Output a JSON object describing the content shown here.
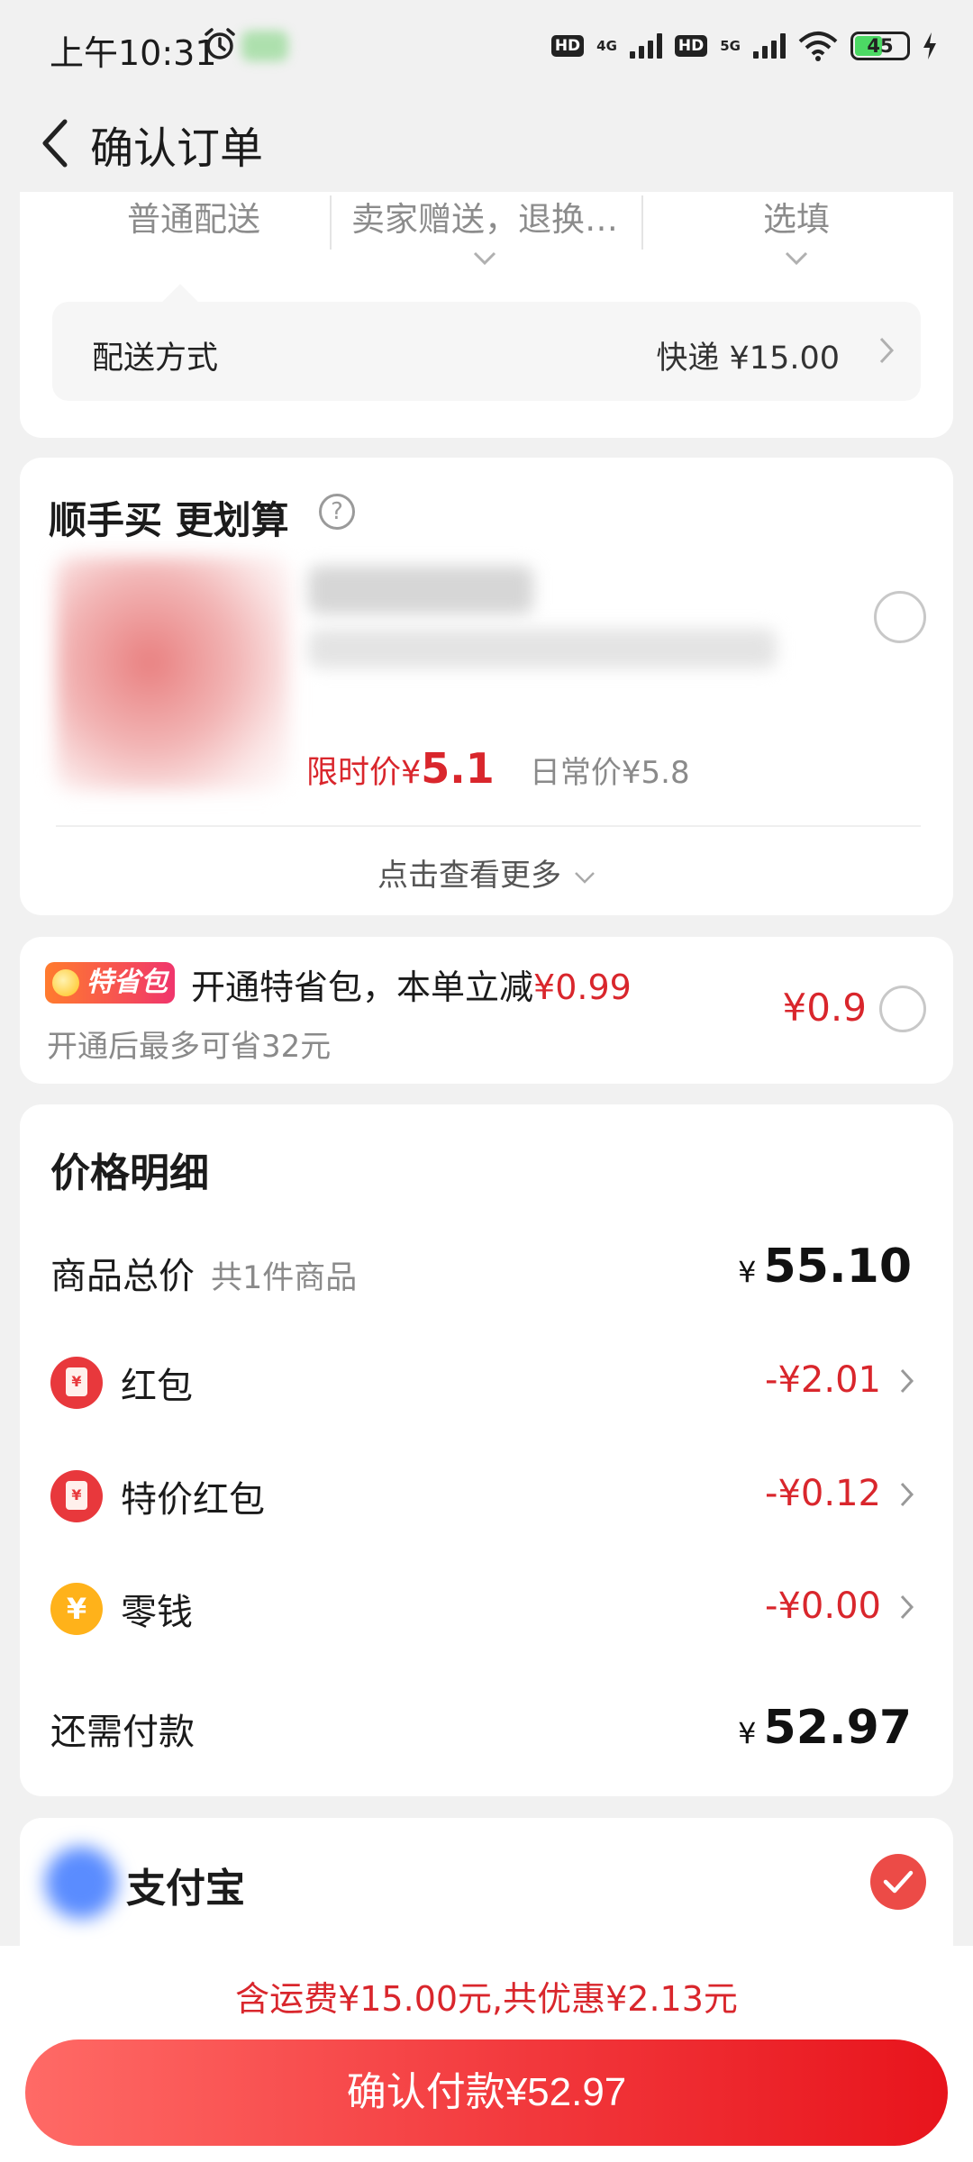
{
  "status_bar": {
    "time": "上午10:31",
    "net1": "4G",
    "net2": "5G",
    "hd": "HD",
    "battery": "45"
  },
  "header": {
    "title": "确认订单"
  },
  "delivery": {
    "options": [
      "普通配送",
      "卖家赠送，退换…",
      "选填"
    ],
    "method_label": "配送方式",
    "method_value": "快递 ¥15.00"
  },
  "addon": {
    "title": "顺手买 更划算",
    "limited_label": "限时价¥",
    "limited_price": "5.1",
    "daily_price": "日常价¥5.8",
    "more": "点击查看更多"
  },
  "saver": {
    "badge": "特省包",
    "title": "开通特省包，本单立减",
    "title_amount": "¥0.99",
    "subtitle": "开通后最多可省32元",
    "price": "¥0.9"
  },
  "price_detail": {
    "title": "价格明细",
    "total_label": "商品总价",
    "total_sub": "共1件商品",
    "total_amount": "55.10",
    "yen": "¥",
    "red_packet_label": "红包",
    "red_packet_amount": "-¥2.01",
    "special_packet_label": "特价红包",
    "special_packet_amount": "-¥0.12",
    "change_label": "零钱",
    "change_amount": "-¥0.00",
    "remaining_label": "还需付款",
    "remaining_amount": "52.97"
  },
  "payment": {
    "method": "支付宝"
  },
  "footer": {
    "summary": "含运费¥15.00元,共优惠¥2.13元",
    "pay_button": "确认付款¥52.97"
  },
  "colors": {
    "accent_red": "#d9262c",
    "button_red": "#f2383c",
    "coin_orange": "#ffb21a"
  }
}
